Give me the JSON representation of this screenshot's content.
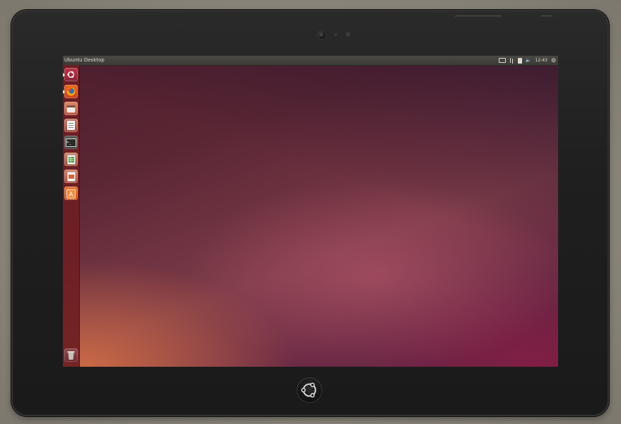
{
  "window": {
    "title": "Ubuntu Desktop"
  },
  "panel": {
    "indicators": [
      "keyboard-indicator",
      "network-indicator",
      "battery-indicator",
      "volume-indicator",
      "clock",
      "session-indicator"
    ],
    "clock": "12:43"
  },
  "launcher": {
    "items": [
      {
        "name": "ubuntu-dash",
        "icon": "ubuntu-logo-icon"
      },
      {
        "name": "firefox",
        "icon": "firefox-icon"
      },
      {
        "name": "files",
        "icon": "files-icon"
      },
      {
        "name": "libreoffice-writer",
        "icon": "writer-icon"
      },
      {
        "name": "terminal",
        "icon": "terminal-icon"
      },
      {
        "name": "libreoffice-calc",
        "icon": "calc-icon"
      },
      {
        "name": "libreoffice-impress",
        "icon": "impress-icon"
      },
      {
        "name": "software-center",
        "icon": "software-center-icon",
        "label": "A"
      },
      {
        "name": "trash",
        "icon": "trash-icon"
      }
    ]
  },
  "colors": {
    "panel": "#3c3b37",
    "launcher": "#6e1e23",
    "tablet_bezel": "#1f1f1f"
  }
}
